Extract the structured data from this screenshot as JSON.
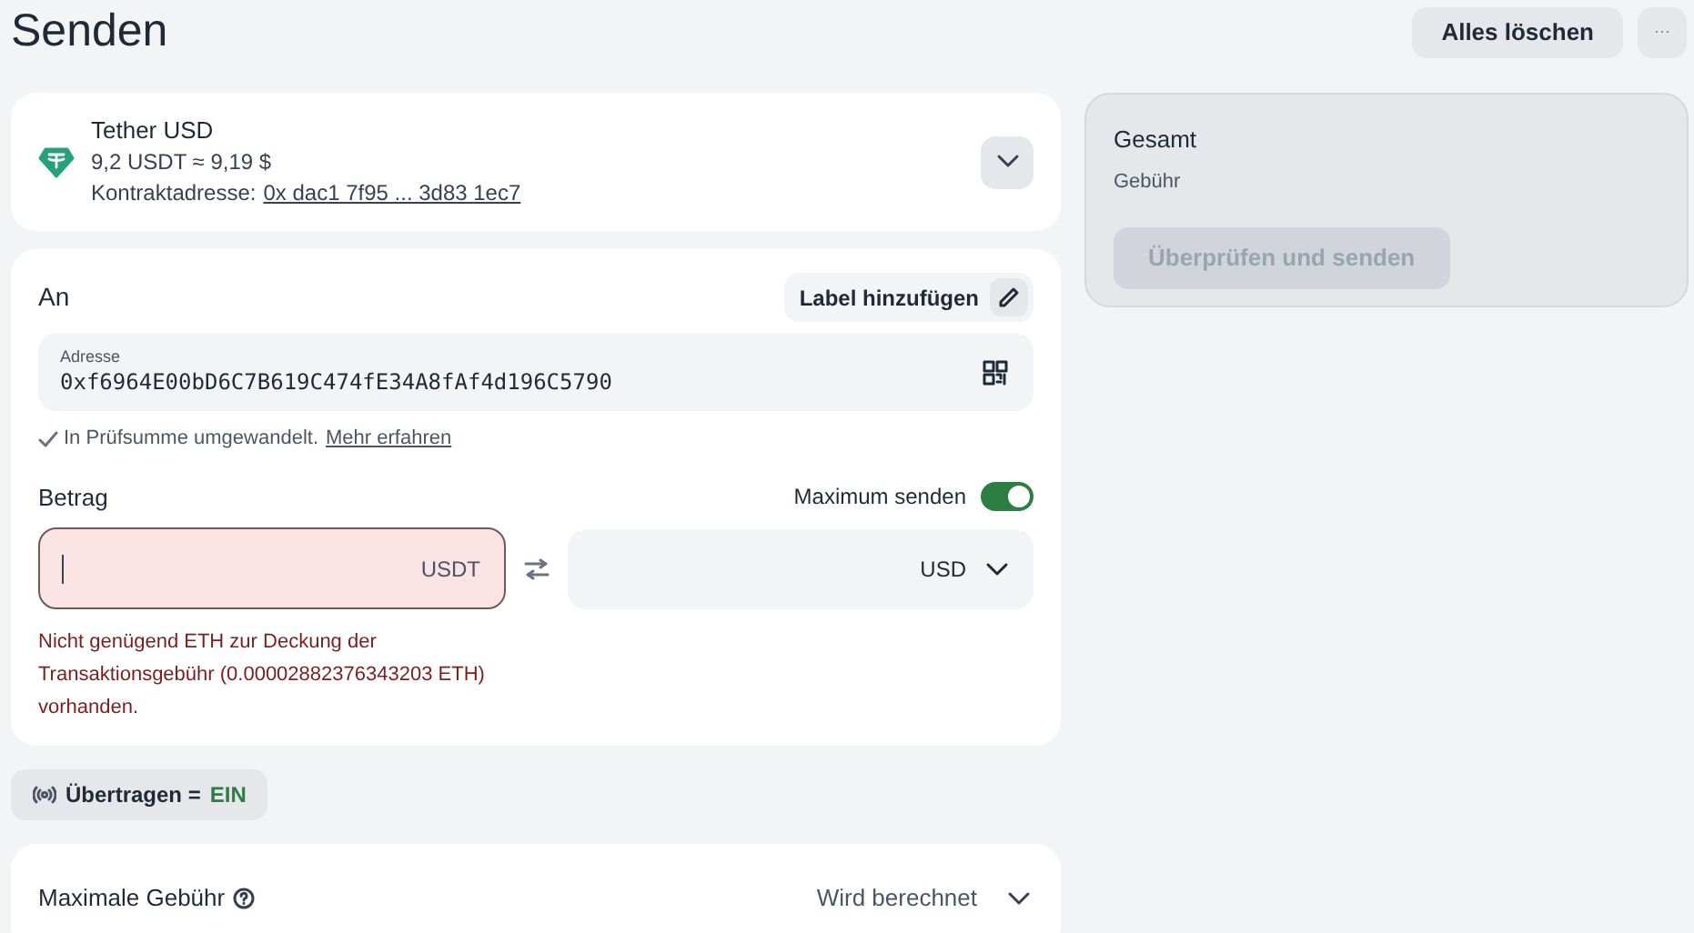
{
  "title": "Senden",
  "header_buttons": {
    "clear": "Alles löschen",
    "more": "···"
  },
  "token": {
    "name": "Tether USD",
    "balance": "9,2 USDT ≈ 9,19 $",
    "contract_label": "Kontraktadresse:",
    "contract_link": "0x dac1 7f95 ... 3d83 1ec7"
  },
  "recipient": {
    "heading": "An",
    "add_label": "Label hinzufügen",
    "address_label": "Adresse",
    "address": "0xf6964E00bD6C7B619C474fE34A8fAf4d196C5790",
    "checksum_note": "In Prüfsumme umgewandelt.",
    "learn_more": "Mehr erfahren"
  },
  "amount": {
    "heading": "Betrag",
    "max_label": "Maximum senden",
    "max_on": true,
    "error": true,
    "unit": "USDT",
    "fiat_unit": "USD",
    "error_text": "Nicht genügend ETH zur Deckung der Transaktionsgebühr (0.00002882376343203 ETH) vorhanden."
  },
  "broadcast": {
    "label": "Übertragen =",
    "value": "EIN",
    "on": true
  },
  "max_fee": {
    "label": "Maximale Gebühr",
    "value": "Wird berechnet"
  },
  "summary": {
    "total": "Gesamt",
    "fee": "Gebühr",
    "review_button": "Überprüfen und senden",
    "disabled": true
  }
}
